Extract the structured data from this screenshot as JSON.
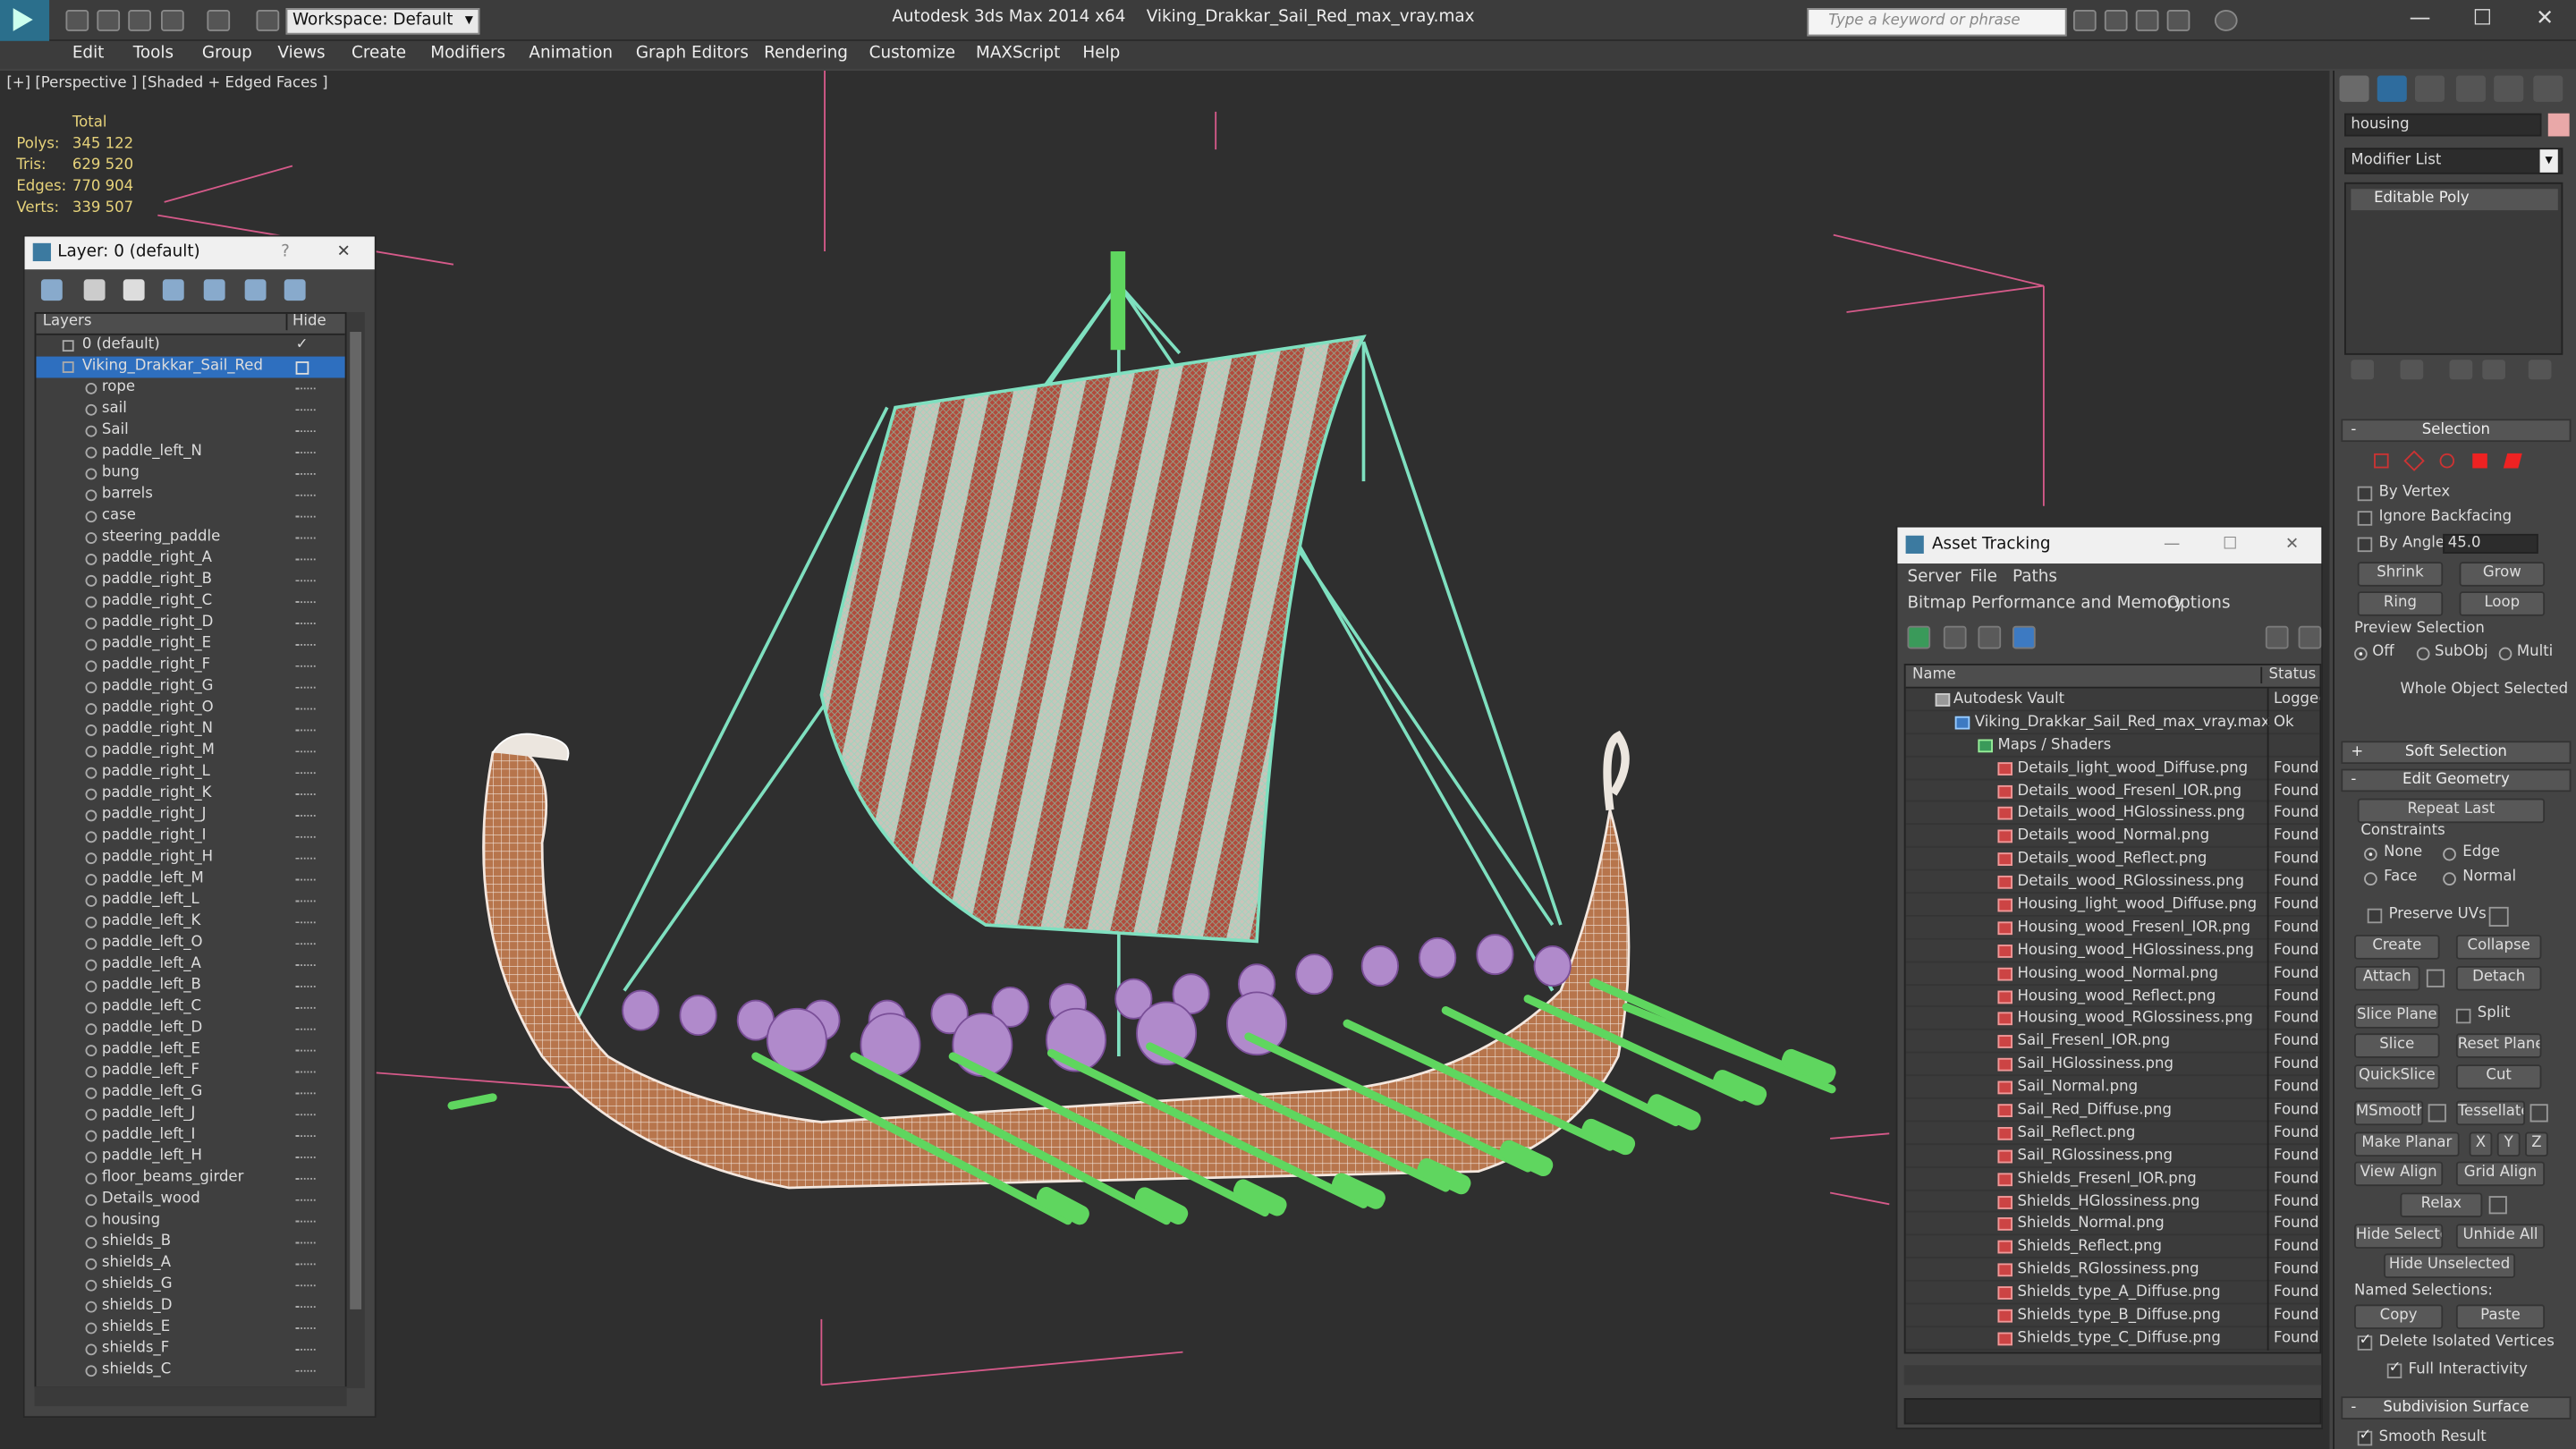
{
  "app": {
    "title": "Autodesk 3ds Max 2014 x64",
    "file_name": "Viking_Drakkar_Sail_Red_max_vray.max",
    "workspace": "Workspace: Default",
    "search_placeholder": "Type a keyword or phrase",
    "menu": [
      "Edit",
      "Tools",
      "Group",
      "Views",
      "Create",
      "Modifiers",
      "Animation",
      "Graph Editors",
      "Rendering",
      "Customize",
      "MAXScript",
      "Help"
    ]
  },
  "viewport": {
    "label": "[+] [Perspective ] [Shaded + Edged Faces ]",
    "stats": {
      "header": "Total",
      "rows": [
        {
          "label": "Polys:",
          "value": "345 122"
        },
        {
          "label": "Tris:",
          "value": "629 520"
        },
        {
          "label": "Edges:",
          "value": "770 904"
        },
        {
          "label": "Verts:",
          "value": "339 507"
        }
      ]
    }
  },
  "layer_dialog": {
    "title": "Layer: 0 (default)",
    "help": "?",
    "close": "✕",
    "col_layers": "Layers",
    "col_hide": "Hide",
    "layers": [
      "0 (default)",
      "Viking_Drakkar_Sail_Red",
      "rope",
      "sail",
      "Sail",
      "paddle_left_N",
      "bung",
      "barrels",
      "case",
      "steering_paddle",
      "paddle_right_A",
      "paddle_right_B",
      "paddle_right_C",
      "paddle_right_D",
      "paddle_right_E",
      "paddle_right_F",
      "paddle_right_G",
      "paddle_right_O",
      "paddle_right_N",
      "paddle_right_M",
      "paddle_right_L",
      "paddle_right_K",
      "paddle_right_J",
      "paddle_right_I",
      "paddle_right_H",
      "paddle_left_M",
      "paddle_left_L",
      "paddle_left_K",
      "paddle_left_O",
      "paddle_left_A",
      "paddle_left_B",
      "paddle_left_C",
      "paddle_left_D",
      "paddle_left_E",
      "paddle_left_F",
      "paddle_left_G",
      "paddle_left_J",
      "paddle_left_I",
      "paddle_left_H",
      "floor_beams_girder",
      "Details_wood",
      "housing",
      "shields_B",
      "shields_A",
      "shields_G",
      "shields_D",
      "shields_E",
      "shields_F",
      "shields_C"
    ]
  },
  "asset_tracking": {
    "title": "Asset Tracking",
    "menu1": [
      "Server",
      "File",
      "Paths"
    ],
    "menu2": [
      "Bitmap Performance and Memory",
      "Options"
    ],
    "col_name": "Name",
    "col_status": "Status",
    "vault": {
      "name": "Autodesk Vault",
      "status": "Logged"
    },
    "file": {
      "name": "Viking_Drakkar_Sail_Red_max_vray.max",
      "status": "Ok"
    },
    "group": "Maps / Shaders",
    "maps": [
      "Details_light_wood_Diffuse.png",
      "Details_wood_Fresenl_IOR.png",
      "Details_wood_HGlossiness.png",
      "Details_wood_Normal.png",
      "Details_wood_Reflect.png",
      "Details_wood_RGlossiness.png",
      "Housing_light_wood_Diffuse.png",
      "Housing_wood_Fresenl_IOR.png",
      "Housing_wood_HGlossiness.png",
      "Housing_wood_Normal.png",
      "Housing_wood_Reflect.png",
      "Housing_wood_RGlossiness.png",
      "Sail_Fresenl_IOR.png",
      "Sail_HGlossiness.png",
      "Sail_Normal.png",
      "Sail_Red_Diffuse.png",
      "Sail_Reflect.png",
      "Sail_RGlossiness.png",
      "Shields_Fresenl_IOR.png",
      "Shields_HGlossiness.png",
      "Shields_Normal.png",
      "Shields_Reflect.png",
      "Shields_RGlossiness.png",
      "Shields_type_A_Diffuse.png",
      "Shields_type_B_Diffuse.png",
      "Shields_type_C_Diffuse.png"
    ],
    "found": "Found"
  },
  "command_panel": {
    "object_name": "housing",
    "modifier_list": "Modifier List",
    "stack_item": "Editable Poly",
    "selection": {
      "title": "Selection",
      "by_vertex": "By Vertex",
      "ignore_backfacing": "Ignore Backfacing",
      "by_angle": "By Angle:",
      "angle": "45.0",
      "shrink": "Shrink",
      "grow": "Grow",
      "ring": "Ring",
      "loop": "Loop",
      "preview": "Preview Selection",
      "off": "Off",
      "subobj": "SubObj",
      "multi": "Multi",
      "status": "Whole Object Selected"
    },
    "soft_selection": "Soft Selection",
    "edit_geometry": {
      "title": "Edit Geometry",
      "repeat_last": "Repeat Last",
      "constraints": "Constraints",
      "none": "None",
      "edge": "Edge",
      "face": "Face",
      "normal": "Normal",
      "preserve_uvs": "Preserve UVs",
      "create": "Create",
      "collapse": "Collapse",
      "attach": "Attach",
      "detach": "Detach",
      "slice_plane": "Slice Plane",
      "split": "Split",
      "slice": "Slice",
      "reset_plane": "Reset Plane",
      "quickslice": "QuickSlice",
      "cut": "Cut",
      "msmooth": "MSmooth",
      "tessellate": "Tessellate",
      "make_planar": "Make Planar",
      "x": "X",
      "y": "Y",
      "z": "Z",
      "view_align": "View Align",
      "grid_align": "Grid Align",
      "relax": "Relax",
      "hide_selected": "Hide Selected",
      "unhide_all": "Unhide All",
      "hide_unselected": "Hide Unselected",
      "named_selections": "Named Selections:",
      "copy": "Copy",
      "paste": "Paste",
      "delete_isolated": "Delete Isolated Vertices",
      "full_interactivity": "Full Interactivity"
    },
    "subdivision": {
      "title": "Subdivision Surface",
      "smooth_result": "Smooth Result"
    }
  },
  "colors": {
    "sail_stripe_red": "#b24a3c",
    "rigging": "#7fe0c0",
    "oars": "#5fd65f",
    "shields": "#b08acb",
    "hull": "#c9875a",
    "stats_text": "#e6d27a",
    "grid_lines": "#d65a8a"
  }
}
